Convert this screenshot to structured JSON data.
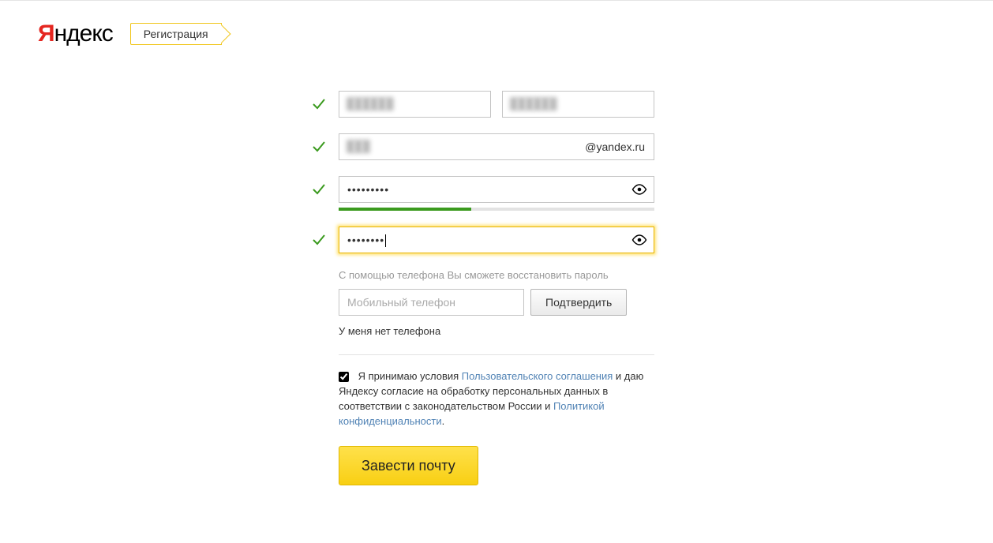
{
  "header": {
    "logo_first": "Я",
    "logo_rest": "ндекс",
    "tag_label": "Регистрация"
  },
  "form": {
    "first_name_value": "██████",
    "last_name_value": "██████",
    "login_value": "███",
    "login_suffix": "@yandex.ru",
    "password_value": "•••••••••",
    "password_confirm_value": "••••••••",
    "password_strength_percent": 42,
    "phone_hint": "С помощью телефона Вы сможете восстановить пароль",
    "phone_placeholder": "Мобильный телефон",
    "confirm_phone_label": "Подтвердить",
    "no_phone_text": "У меня нет телефона",
    "agree_prefix": "Я принимаю условия ",
    "agree_link1": "Пользовательского соглашения",
    "agree_mid": "и даю Яндексу согласие на обработку персональных данных в соответствии с законодательством России и ",
    "agree_link2": "Политикой конфиденциальности",
    "agree_suffix": ".",
    "agree_checked": true,
    "submit_label": "Завести почту"
  }
}
